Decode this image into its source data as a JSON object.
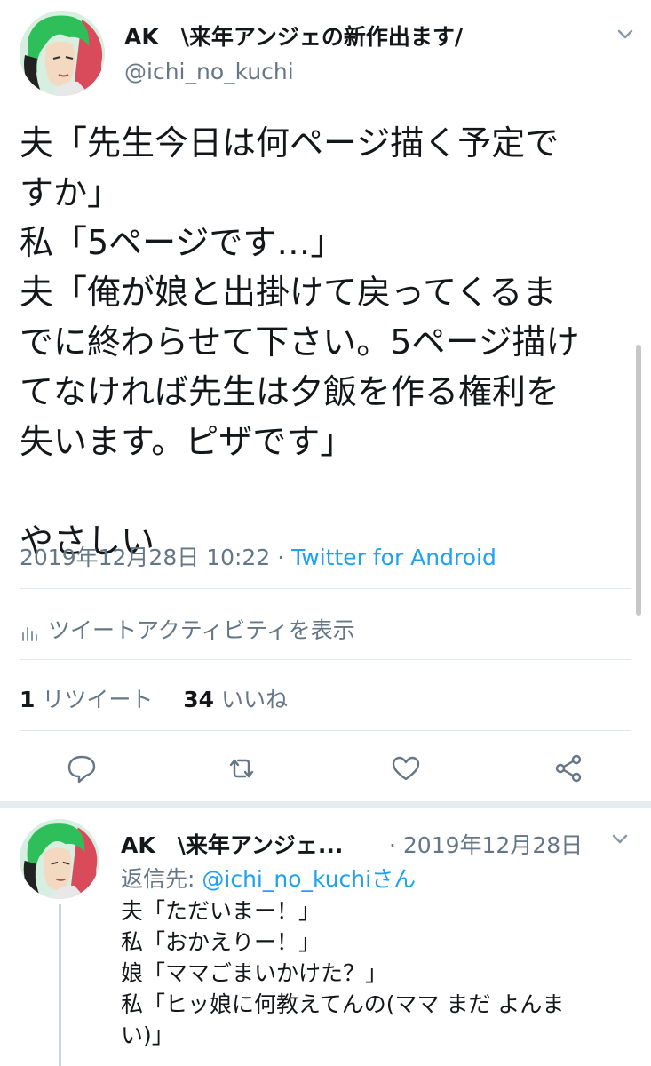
{
  "tweet": {
    "display_name": "AK　\\来年アンジェの新作出ます/",
    "handle": "@ichi_no_kuchi",
    "body_lines": [
      "夫「先生今日は何ページ描く予定で",
      "すか」",
      "私「5ページです…」",
      "夫「俺が娘と出掛けて戻ってくるま",
      "でに終わらせて下さい。5ページ描け",
      "てなければ先生は夕飯を作る権利を",
      "失います。ピザです」",
      "",
      "やさしい"
    ],
    "timestamp": "2019年12月28日 10:22",
    "separator": "·",
    "client": "Twitter for Android",
    "activity_label": "ツイートアクティビティを表示",
    "retweets": {
      "count": "1",
      "label": "リツイート"
    },
    "likes": {
      "count": "34",
      "label": "いいね"
    }
  },
  "reply": {
    "display_name": "AK　\\来年アンジェ...",
    "date": "· 2019年12月28日",
    "reply_to_prefix": "返信先: ",
    "reply_to_handle": "@ichi_no_kuchi",
    "reply_to_suffix": "さん",
    "body_lines": [
      "夫「ただいまー！」",
      "私「おかえりー！」",
      "娘「ママごまいかけた？」",
      "私「ヒッ娘に何教えてんの(ママ まだ よんま",
      "い)」"
    ]
  },
  "icons": [
    "chevron-down-icon",
    "bar-chart-icon",
    "reply-icon",
    "retweet-icon",
    "like-icon",
    "share-icon"
  ],
  "colors": {
    "link": "#1da1f2",
    "secondary": "#657786",
    "divider": "#e1e8ed",
    "text": "#14171a"
  }
}
